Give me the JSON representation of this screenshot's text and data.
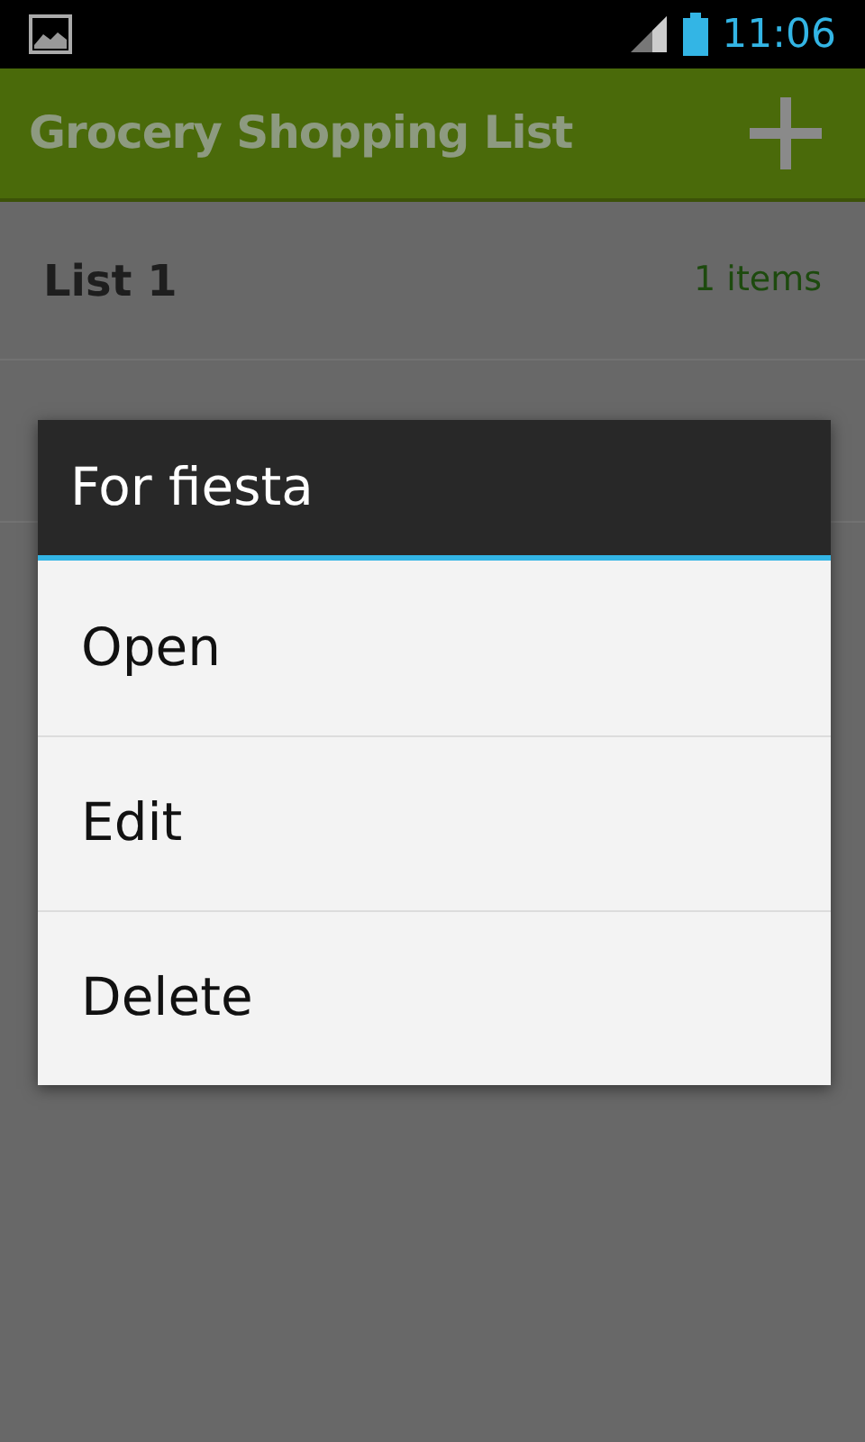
{
  "status_bar": {
    "time": "11:06"
  },
  "app_bar": {
    "title": "Grocery Shopping List"
  },
  "lists": [
    {
      "name": "List 1",
      "count": "1 items"
    }
  ],
  "dialog": {
    "title": "For fiesta",
    "options": [
      "Open",
      "Edit",
      "Delete"
    ]
  }
}
